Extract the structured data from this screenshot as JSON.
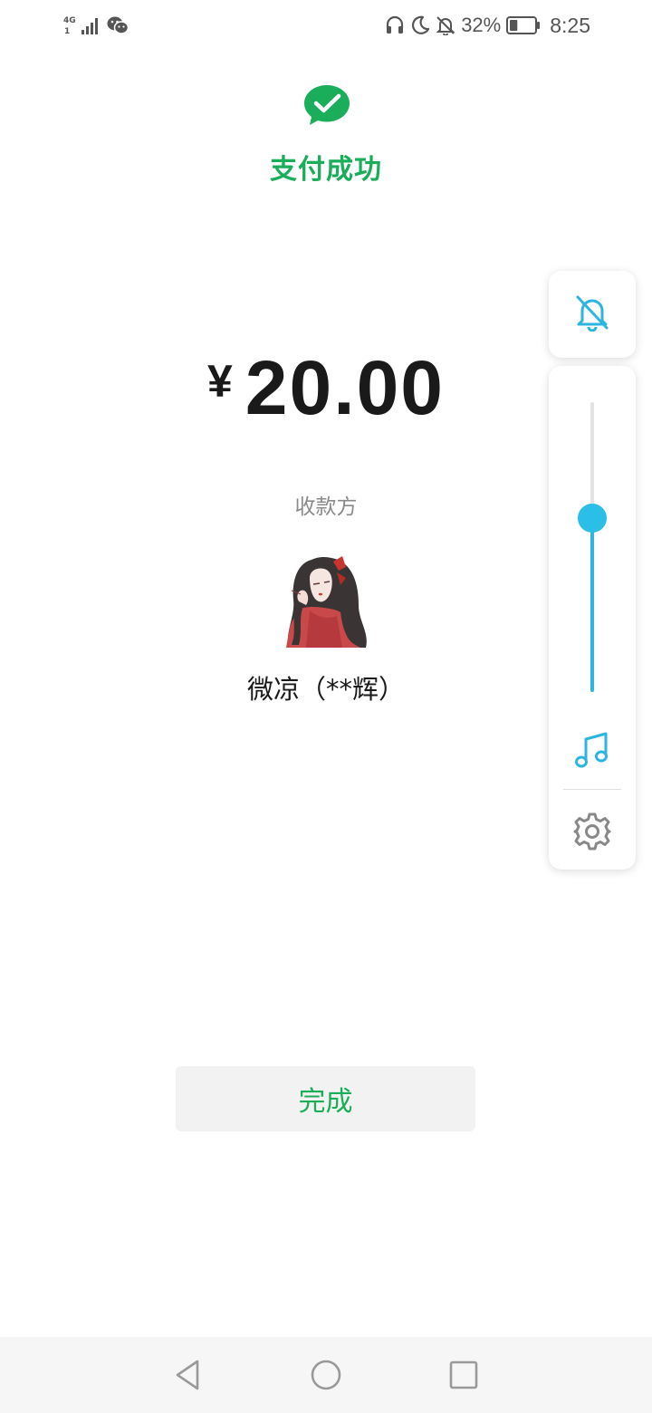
{
  "status_bar": {
    "network_type": "4G",
    "sim_slot": "1",
    "battery_percent_text": "32%",
    "battery_level": 0.32,
    "time": "8:25",
    "left_icons": [
      "network-4g-icon",
      "signal-icon",
      "wechat-icon"
    ],
    "right_icons": [
      "headphones-icon",
      "moon-icon",
      "bell-off-icon",
      "battery-icon"
    ]
  },
  "success": {
    "title": "支付成功",
    "icon": "wechat-pay-check-icon"
  },
  "payment": {
    "currency_symbol": "¥",
    "amount": "20.00",
    "payee_label": "收款方",
    "payee_name": "微凉（**辉）"
  },
  "actions": {
    "done_label": "完成"
  },
  "volume_panel": {
    "mute_icon": "bell-off-icon",
    "level": 0.6,
    "music_icon": "music-note-icon",
    "settings_icon": "gear-icon"
  },
  "nav_bar": {
    "icons": [
      "back-triangle-icon",
      "home-circle-icon",
      "recents-square-icon"
    ]
  },
  "colors": {
    "brand_green": "#1aad5a",
    "accent_blue": "#2bb5e0",
    "text_dark": "#1a1a1a",
    "text_gray": "#8a8a8a",
    "button_bg": "#f2f2f2"
  }
}
